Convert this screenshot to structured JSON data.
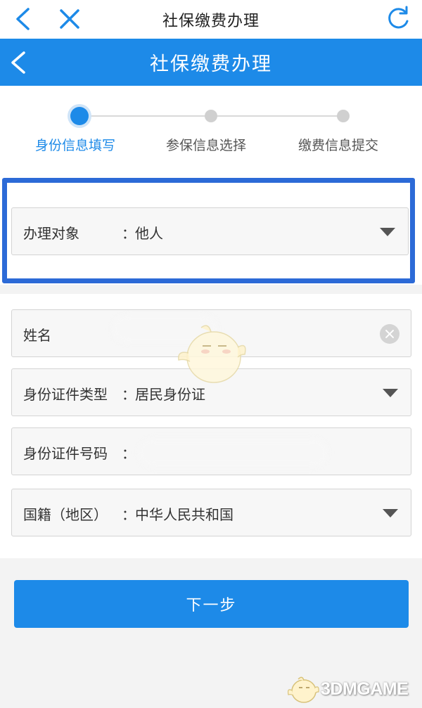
{
  "browser": {
    "title": "社保缴费办理"
  },
  "header": {
    "title": "社保缴费办理"
  },
  "steps": [
    {
      "label": "身份信息填写",
      "active": true
    },
    {
      "label": "参保信息选择",
      "active": false
    },
    {
      "label": "缴费信息提交",
      "active": false
    }
  ],
  "form": {
    "subject": {
      "label": "办理对象",
      "colon": "：",
      "value": "他人"
    },
    "name": {
      "label": "姓名",
      "value": ""
    },
    "id_type": {
      "label": "身份证件类型",
      "colon": "：",
      "value": "居民身份证"
    },
    "id_number": {
      "label": "身份证件号码",
      "colon": "：",
      "value": ""
    },
    "nationality": {
      "label": "国籍（地区）",
      "colon": "：",
      "value": "中华人民共和国"
    }
  },
  "actions": {
    "next_label": "下一步"
  },
  "watermark": {
    "text": "3DMGAME"
  },
  "colors": {
    "primary": "#1d8ae8",
    "highlight_border": "#2c6ad7",
    "inactive_dot": "#d0d0d0"
  }
}
